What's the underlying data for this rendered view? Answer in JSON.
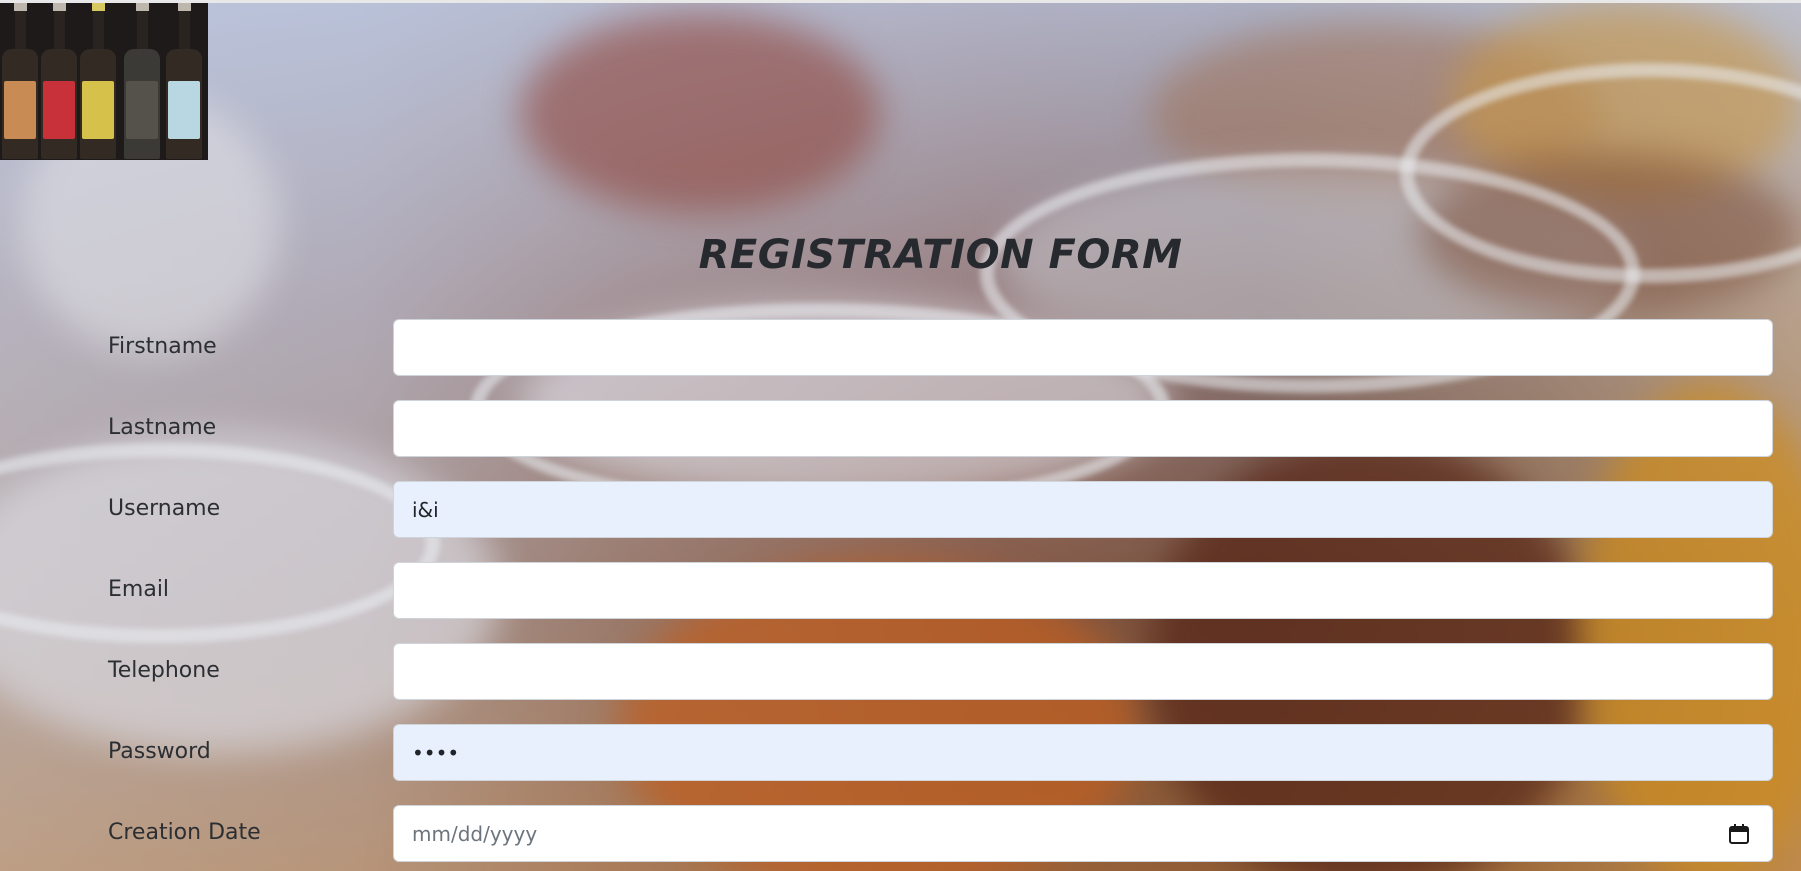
{
  "form": {
    "title": "REGISTRATION FORM",
    "fields": [
      {
        "label": "Firstname",
        "value": ""
      },
      {
        "label": "Lastname",
        "value": ""
      },
      {
        "label": "Username",
        "value": "i&i"
      },
      {
        "label": "Email",
        "value": ""
      },
      {
        "label": "Telephone",
        "value": ""
      },
      {
        "label": "Password",
        "value": "••••"
      },
      {
        "label": "Creation Date",
        "value": "",
        "placeholder": "mm/dd/yyyy"
      }
    ]
  },
  "icons": {
    "calendar": "calendar-icon"
  },
  "colors": {
    "autofill_bg": "#e8f0fe",
    "input_border": "#ced4da",
    "title": "#262a2e"
  }
}
